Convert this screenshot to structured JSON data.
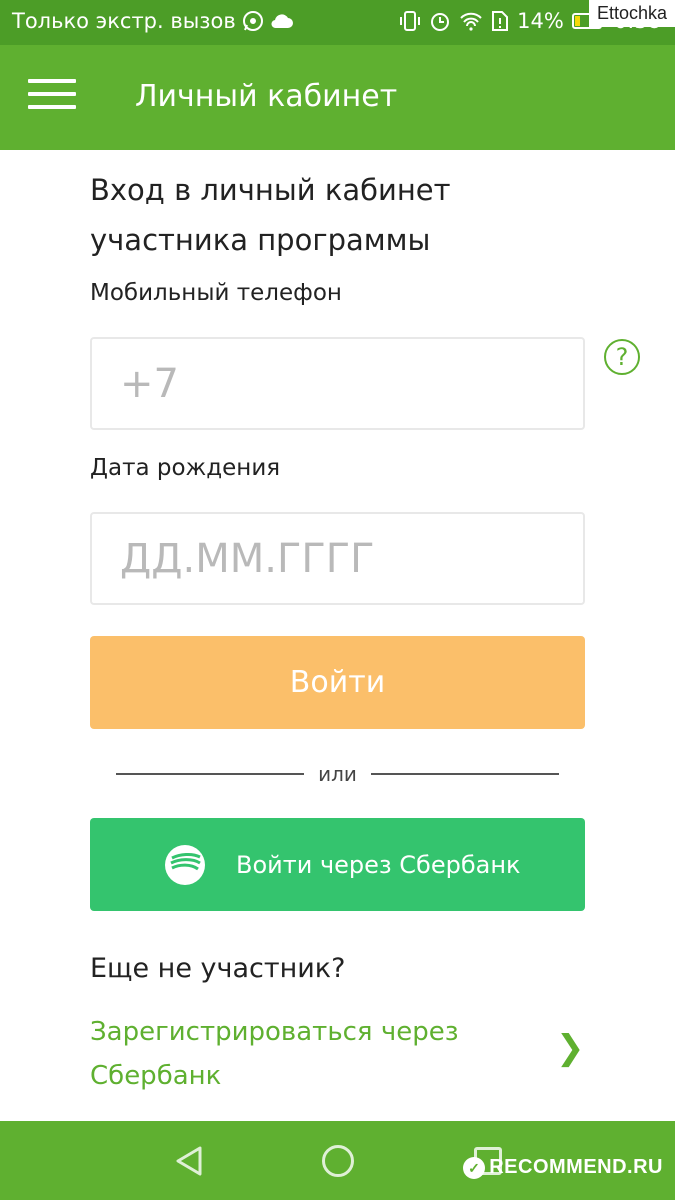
{
  "status_bar": {
    "carrier": "Только экстр. вызов",
    "battery": "14%",
    "time": "0:38"
  },
  "watermark": {
    "top": "Ettochka",
    "bottom": "RECOMMEND.RU"
  },
  "app_bar": {
    "title": "Личный кабинет"
  },
  "form": {
    "title": "Вход в личный кабинет участника программы",
    "phone_label": "Мобильный телефон",
    "phone_placeholder": "+7",
    "dob_label": "Дата рождения",
    "dob_placeholder": "ДД.ММ.ГГГГ",
    "help_icon": "?",
    "login_button": "Войти",
    "divider": "или",
    "sber_button": "Войти через Сбербанк"
  },
  "register": {
    "heading": "Еще не участник?",
    "link": "Зарегистрироваться через Сбербанк",
    "chevron": "❯"
  },
  "colors": {
    "status_bar": "#4c9d27",
    "app_bar": "#5fb030",
    "login_button": "#fbbf6a",
    "sber_button": "#34c46e",
    "link": "#5fb030"
  }
}
